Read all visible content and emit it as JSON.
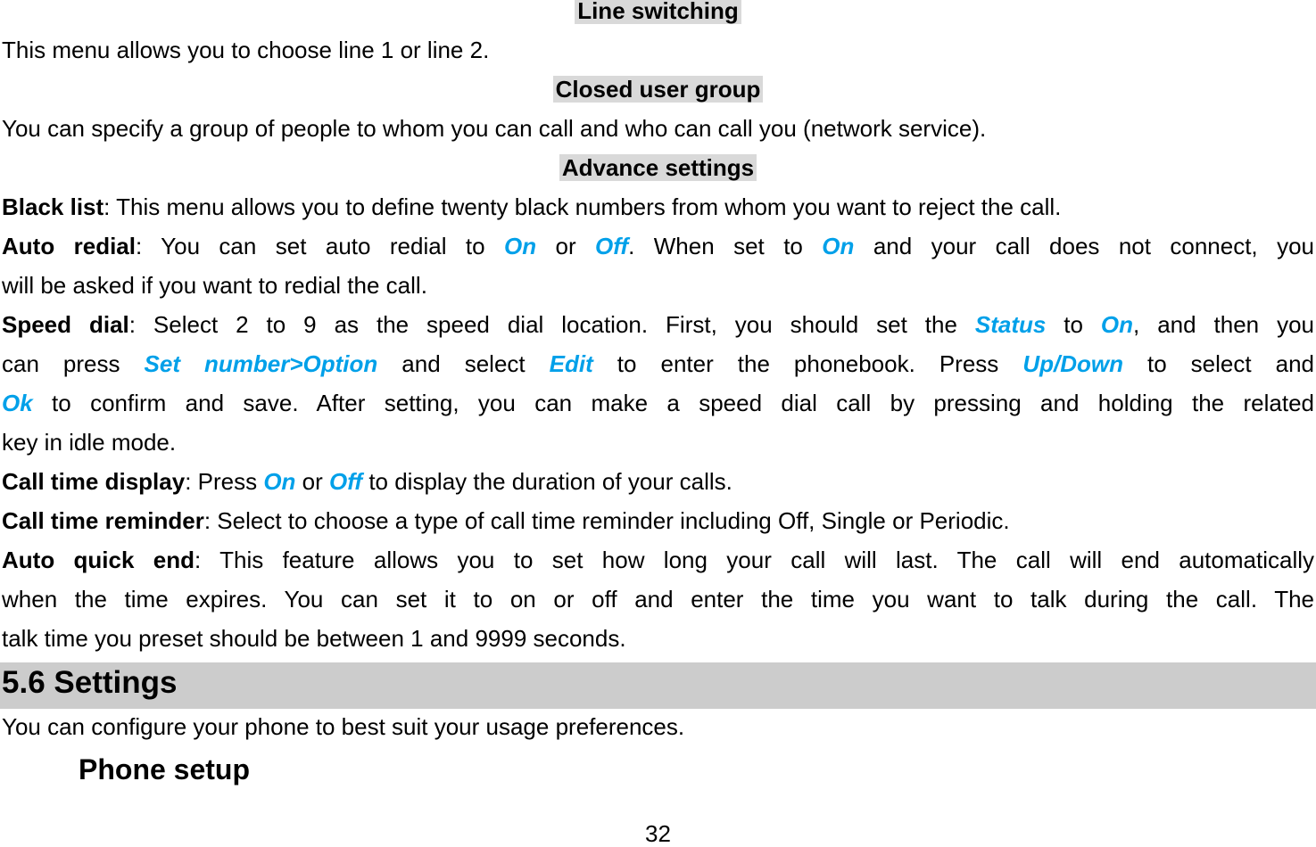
{
  "headings": {
    "line_switching": "Line switching",
    "closed_user_group": "Closed user group",
    "advance_settings": "Advance settings"
  },
  "paragraphs": {
    "line_switching_text": "This menu allows you to choose line 1 or line 2.",
    "closed_user_group_text": "You can specify a group of people to whom you can call and who can call you (network service).",
    "black_list": {
      "term": "Black list",
      "text": ": This menu allows you to define twenty black numbers from whom you want to reject the call."
    },
    "auto_redial": {
      "term": "Auto redial",
      "t1": ": You can set auto redial to ",
      "k1": "On",
      "t2": " or ",
      "k2": "Off",
      "t3": ". When set to ",
      "k3": "On",
      "t4": " and your call does not connect, you",
      "line2": "will be asked if you want to redial the call."
    },
    "speed_dial": {
      "term": "Speed dial",
      "t1": ": Select 2 to 9 as the speed dial location. First, you should set the ",
      "k1": "Status",
      "t2": " to ",
      "k2": "On",
      "t3": ", and then you",
      "l2_t1": "can press ",
      "l2_k1": "Set number>Option",
      "l2_t2": " and select ",
      "l2_k2": "Edit",
      "l2_t3": " to enter the phonebook. Press ",
      "l2_k3": "Up/Down",
      "l2_t4": " to select and",
      "l3_k1": "Ok",
      "l3_t1": " to confirm and save. After setting, you can make a speed dial call by pressing and holding the related",
      "line4": "key in idle mode."
    },
    "call_time_display": {
      "term": "Call time display",
      "t1": ": Press ",
      "k1": "On",
      "t2": " or ",
      "k2": "Off",
      "t3": " to display the duration of your calls."
    },
    "call_time_reminder": {
      "term": "Call time reminder",
      "text": ": Select to choose a type of call time reminder including Off, Single or Periodic."
    },
    "auto_quick_end": {
      "term": "Auto quick end",
      "text": ": This feature allows you to set how long your call will last. The call will end automatically",
      "line2": "when the time expires. You can set it to on or off and enter the time you want to talk during the call. The",
      "line3": "talk time you preset should be between 1 and 9999 seconds."
    }
  },
  "section": {
    "title": "5.6  Settings",
    "intro": "You can configure your phone to best suit your usage preferences.",
    "subheading": "Phone setup"
  },
  "page_number": "32",
  "colors": {
    "keyword": "#00a0e9",
    "heading_highlight": "#d9d9d9",
    "section_bar": "#cccccc"
  }
}
